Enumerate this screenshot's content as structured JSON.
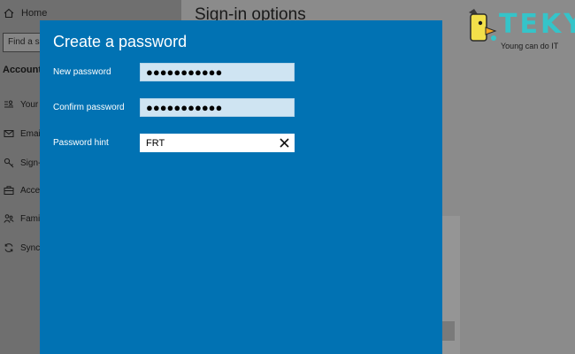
{
  "background": {
    "home_label": "Home",
    "search_placeholder": "Find a s",
    "section_heading": "Accounts",
    "page_title": "Sign-in options",
    "sidebar_items": [
      {
        "icon": "person-card-icon",
        "label": "Your"
      },
      {
        "icon": "mail-icon",
        "label": "Email"
      },
      {
        "icon": "key-icon",
        "label": "Sign-"
      },
      {
        "icon": "briefcase-icon",
        "label": "Acces"
      },
      {
        "icon": "people-icon",
        "label": "Famil"
      },
      {
        "icon": "sync-icon",
        "label": "Sync"
      }
    ]
  },
  "logo": {
    "word": "TEKY",
    "tagline": "Young can do IT",
    "accent": "#35c4c9",
    "mascot_color": "#f2e04a"
  },
  "dialog": {
    "title": "Create a password",
    "accent": "#0172b3",
    "new_password": {
      "label": "New password",
      "value": "●●●●●●●●●●●"
    },
    "confirm_password": {
      "label": "Confirm password",
      "value": "●●●●●●●●●●●"
    },
    "password_hint": {
      "label": "Password hint",
      "value": "FRT",
      "clear_icon": "close-icon"
    }
  }
}
